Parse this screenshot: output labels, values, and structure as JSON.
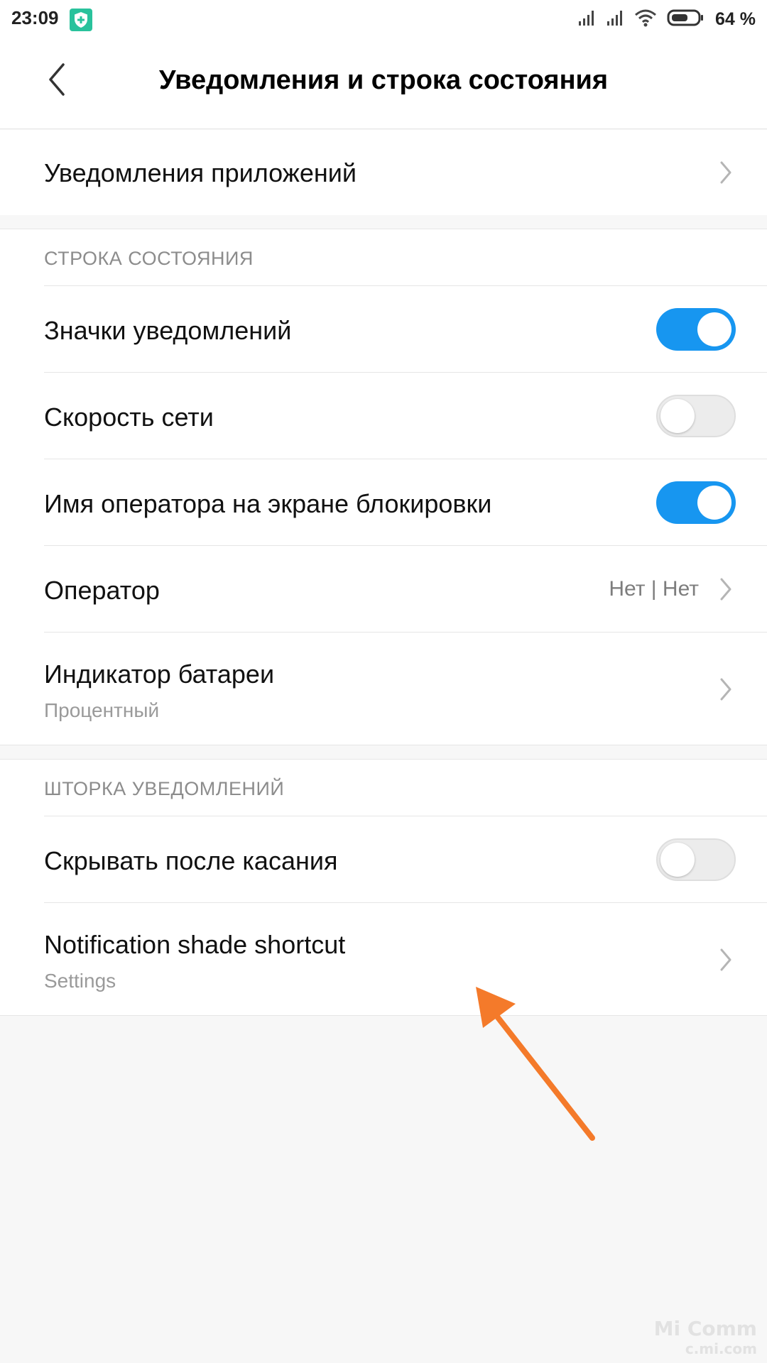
{
  "status_bar": {
    "time": "23:09",
    "battery_percent": "64 %"
  },
  "header": {
    "title": "Уведомления и строка состояния"
  },
  "app_notifications": {
    "label": "Уведомления приложений"
  },
  "status_bar_section": {
    "header": "СТРОКА СОСТОЯНИЯ",
    "notification_icons": {
      "label": "Значки уведомлений",
      "enabled": true
    },
    "network_speed": {
      "label": "Скорость сети",
      "enabled": false
    },
    "carrier_name_lockscreen": {
      "label": "Имя оператора на экране блокировки",
      "enabled": true
    },
    "carrier": {
      "label": "Оператор",
      "value": "Нет | Нет"
    },
    "battery_indicator": {
      "label": "Индикатор батареи",
      "value": "Процентный"
    }
  },
  "notification_shade_section": {
    "header": "ШТОРКА УВЕДОМЛЕНИЙ",
    "hide_after_tap": {
      "label": "Скрывать после касания",
      "enabled": false
    },
    "shade_shortcut": {
      "label": "Notification shade shortcut",
      "value": "Settings"
    }
  },
  "watermark": {
    "line1": "Mi Comm",
    "line2": "c.mi.com"
  },
  "colors": {
    "toggle_on": "#1796f0",
    "arrow_annotation": "#f47a2a",
    "status_shield": "#29c29c"
  }
}
